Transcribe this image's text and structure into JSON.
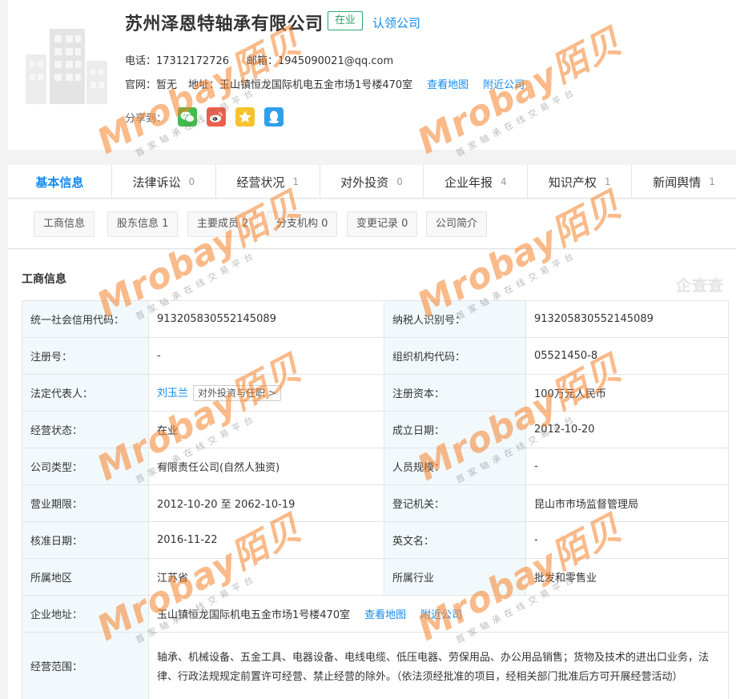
{
  "company": {
    "name": "苏州泽恩特轴承有限公司",
    "status": "在业",
    "claim": "认领公司",
    "phone_label": "电话：",
    "phone": "17312172726",
    "email_label": "邮箱：",
    "email": "1945090021@qq.com",
    "website_label": "官网：",
    "website": "暂无",
    "address_label": "地址：",
    "address": "玉山镇恒龙国际机电五金市场1号楼470室",
    "view_map": "查看地图",
    "nearby": "附近公司",
    "share_label": "分享到："
  },
  "share_icons": [
    "wechat-icon",
    "weibo-icon",
    "qzone-icon",
    "qq-icon"
  ],
  "tabs": [
    {
      "label": "基本信息",
      "count": ""
    },
    {
      "label": "法律诉讼",
      "count": "0"
    },
    {
      "label": "经营状况",
      "count": "1"
    },
    {
      "label": "对外投资",
      "count": "0"
    },
    {
      "label": "企业年报",
      "count": "4"
    },
    {
      "label": "知识产权",
      "count": "1"
    },
    {
      "label": "新闻舆情",
      "count": "1"
    }
  ],
  "subtabs": [
    "工商信息",
    "股东信息 1",
    "主要成员 2",
    "分支机构 0",
    "变更记录 0",
    "公司简介"
  ],
  "section_title": "工商信息",
  "brand_mark": "企查查",
  "rows": [
    {
      "l1": "统一社会信用代码：",
      "v1": "913205830552145089",
      "l2": "纳税人识别号：",
      "v2": "913205830552145089"
    },
    {
      "l1": "注册号：",
      "v1": "-",
      "l2": "组织机构代码：",
      "v2": "05521450-8"
    },
    {
      "l1": "法定代表人：",
      "v1": "刘玉兰",
      "l2": "注册资本：",
      "v2": "100万元人民币"
    },
    {
      "l1": "经营状态：",
      "v1": "在业",
      "l2": "成立日期：",
      "v2": "2012-10-20"
    },
    {
      "l1": "公司类型：",
      "v1": "有限责任公司(自然人独资)",
      "l2": "人员规模：",
      "v2": "-"
    },
    {
      "l1": "营业期限：",
      "v1": "2012-10-20 至 2062-10-19",
      "l2": "登记机关：",
      "v2": "昆山市市场监督管理局"
    },
    {
      "l1": "核准日期：",
      "v1": "2016-11-22",
      "l2": "英文名：",
      "v2": "-"
    },
    {
      "l1": "所属地区",
      "v1": "江苏省",
      "l2": "所属行业",
      "v2": "批发和零售业"
    }
  ],
  "rep_button": "对外投资与任职 >",
  "address_row": {
    "label": "企业地址：",
    "value": "玉山镇恒龙国际机电五金市场1号楼470室",
    "view_map": "查看地图",
    "nearby": "附近公司"
  },
  "scope_row": {
    "label": "经营范围：",
    "value": "轴承、机械设备、五金工具、电器设备、电线电缆、低压电器、劳保用品、办公用品销售；货物及技术的进出口业务，法律、行政法规规定前置许可经营、禁止经营的除外。（依法须经批准的项目，经相关部门批准后方可开展经营活动）"
  },
  "watermark": {
    "main": "Mrobay",
    "accent": "陌贝",
    "sub": "首家轴承在线交易平台"
  },
  "colors": {
    "link": "#128bed",
    "status": "#2aa66b",
    "label_bg": "#f2f9fc",
    "border": "#e4e4e4"
  }
}
